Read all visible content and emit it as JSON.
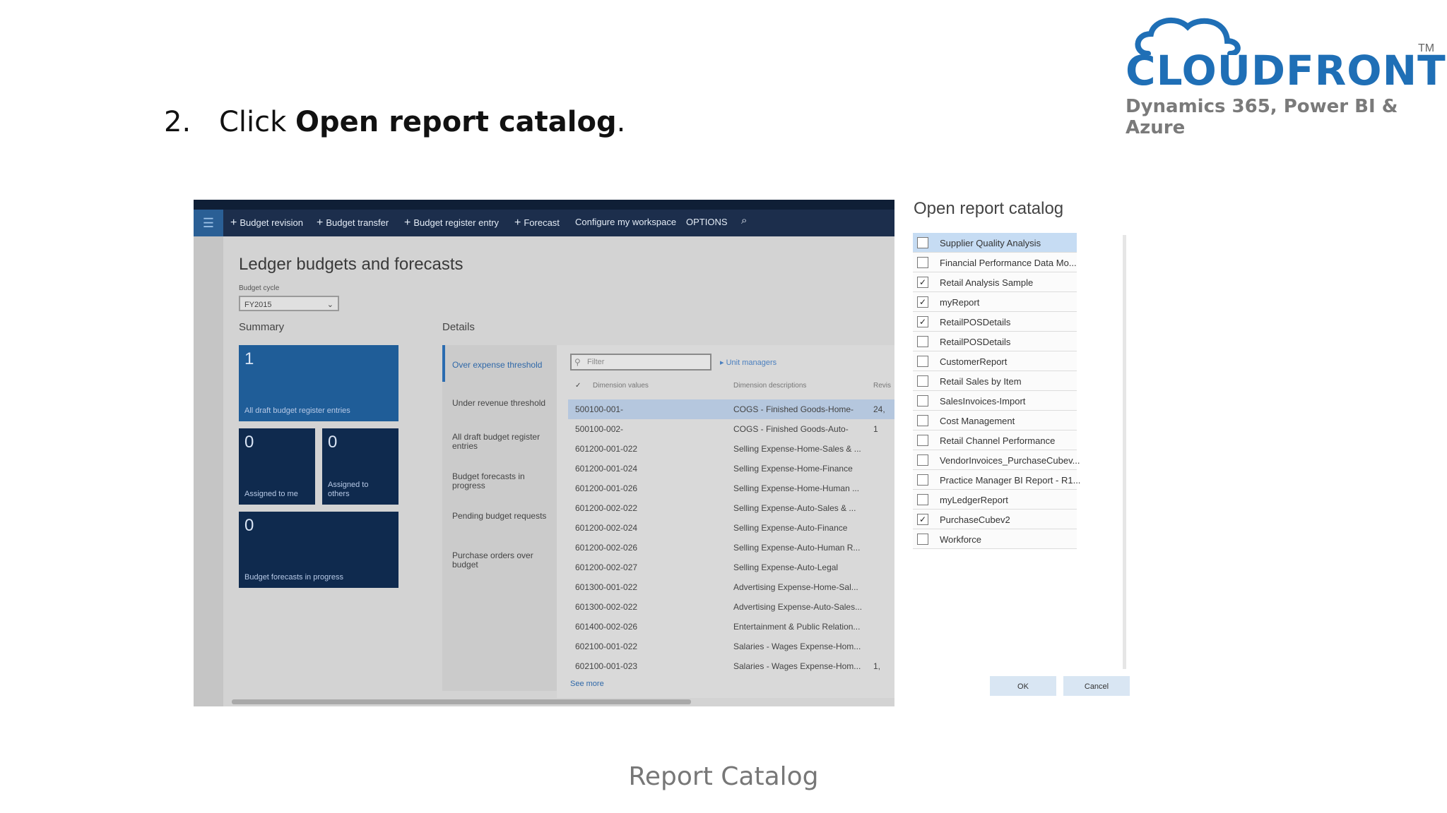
{
  "slide": {
    "step_number": "2.",
    "step_prefix": "Click ",
    "step_bold": "Open report catalog",
    "step_suffix": ".",
    "caption": "Report Catalog"
  },
  "logo": {
    "brand": "CLOUDFRONTS",
    "trademark": "TM",
    "tagline": "Dynamics 365, Power BI & Azure"
  },
  "app": {
    "menu_icon": "hamburger-icon",
    "commands": [
      {
        "label": "Budget revision"
      },
      {
        "label": "Budget transfer"
      },
      {
        "label": "Budget register entry"
      },
      {
        "label": "Forecast"
      },
      {
        "label": "Configure my workspace"
      },
      {
        "label": "OPTIONS"
      }
    ],
    "page_title": "Ledger budgets and forecasts",
    "budget_cycle_label": "Budget cycle",
    "budget_cycle_value": "FY2015",
    "summary_heading": "Summary",
    "details_heading": "Details",
    "tiles": [
      {
        "count": "1",
        "label": "All draft budget register entries"
      },
      {
        "count": "0",
        "label": "Assigned to me"
      },
      {
        "count": "0",
        "label": "Assigned to others"
      },
      {
        "count": "0",
        "label": "Budget forecasts in progress"
      }
    ],
    "detail_nav": [
      {
        "label": "Over expense threshold"
      },
      {
        "label": "Under revenue threshold"
      },
      {
        "label": "All draft budget register entries"
      },
      {
        "label": "Budget forecasts in progress"
      },
      {
        "label": "Pending budget requests"
      },
      {
        "label": "Purchase orders over budget"
      }
    ],
    "filter_placeholder": "Filter",
    "unit_managers": "Unit managers",
    "columns": [
      "Dimension values",
      "Dimension descriptions",
      "Revis"
    ],
    "rows": [
      {
        "value": "500100-001-",
        "desc": "COGS - Finished Goods-Home-",
        "rev": "24,"
      },
      {
        "value": "500100-002-",
        "desc": "COGS - Finished Goods-Auto-",
        "rev": "1"
      },
      {
        "value": "601200-001-022",
        "desc": "Selling Expense-Home-Sales & ...",
        "rev": ""
      },
      {
        "value": "601200-001-024",
        "desc": "Selling Expense-Home-Finance",
        "rev": ""
      },
      {
        "value": "601200-001-026",
        "desc": "Selling Expense-Home-Human ...",
        "rev": ""
      },
      {
        "value": "601200-002-022",
        "desc": "Selling Expense-Auto-Sales & ...",
        "rev": ""
      },
      {
        "value": "601200-002-024",
        "desc": "Selling Expense-Auto-Finance",
        "rev": ""
      },
      {
        "value": "601200-002-026",
        "desc": "Selling Expense-Auto-Human R...",
        "rev": ""
      },
      {
        "value": "601200-002-027",
        "desc": "Selling Expense-Auto-Legal",
        "rev": ""
      },
      {
        "value": "601300-001-022",
        "desc": "Advertising Expense-Home-Sal...",
        "rev": ""
      },
      {
        "value": "601300-002-022",
        "desc": "Advertising Expense-Auto-Sales...",
        "rev": ""
      },
      {
        "value": "601400-002-026",
        "desc": "Entertainment & Public Relation...",
        "rev": ""
      },
      {
        "value": "602100-001-022",
        "desc": "Salaries - Wages Expense-Hom...",
        "rev": ""
      },
      {
        "value": "602100-001-023",
        "desc": "Salaries - Wages Expense-Hom...",
        "rev": "1,"
      }
    ],
    "see_more": "See more"
  },
  "catalog": {
    "title": "Open report catalog",
    "items": [
      {
        "label": "Supplier Quality Analysis",
        "checked": false
      },
      {
        "label": "Financial Performance Data Mo...",
        "checked": false
      },
      {
        "label": "Retail Analysis Sample",
        "checked": true
      },
      {
        "label": "myReport",
        "checked": true
      },
      {
        "label": "RetailPOSDetails",
        "checked": true
      },
      {
        "label": "RetailPOSDetails",
        "checked": false
      },
      {
        "label": "CustomerReport",
        "checked": false
      },
      {
        "label": "Retail Sales by Item",
        "checked": false
      },
      {
        "label": "SalesInvoices-Import",
        "checked": false
      },
      {
        "label": "Cost Management",
        "checked": false
      },
      {
        "label": "Retail Channel Performance",
        "checked": false
      },
      {
        "label": "VendorInvoices_PurchaseCubev...",
        "checked": false
      },
      {
        "label": "Practice Manager BI Report - R1...",
        "checked": false
      },
      {
        "label": "myLedgerReport",
        "checked": false
      },
      {
        "label": "PurchaseCubev2",
        "checked": true
      },
      {
        "label": "Workforce",
        "checked": false
      }
    ],
    "ok_label": "OK",
    "cancel_label": "Cancel"
  },
  "colors": {
    "brand_blue": "#1f6fb6",
    "nav_dark": "#1c2e4c",
    "tile_blue": "#1f5d98",
    "tile_dark": "#0f2a4e",
    "selection": "#b5c7de"
  }
}
